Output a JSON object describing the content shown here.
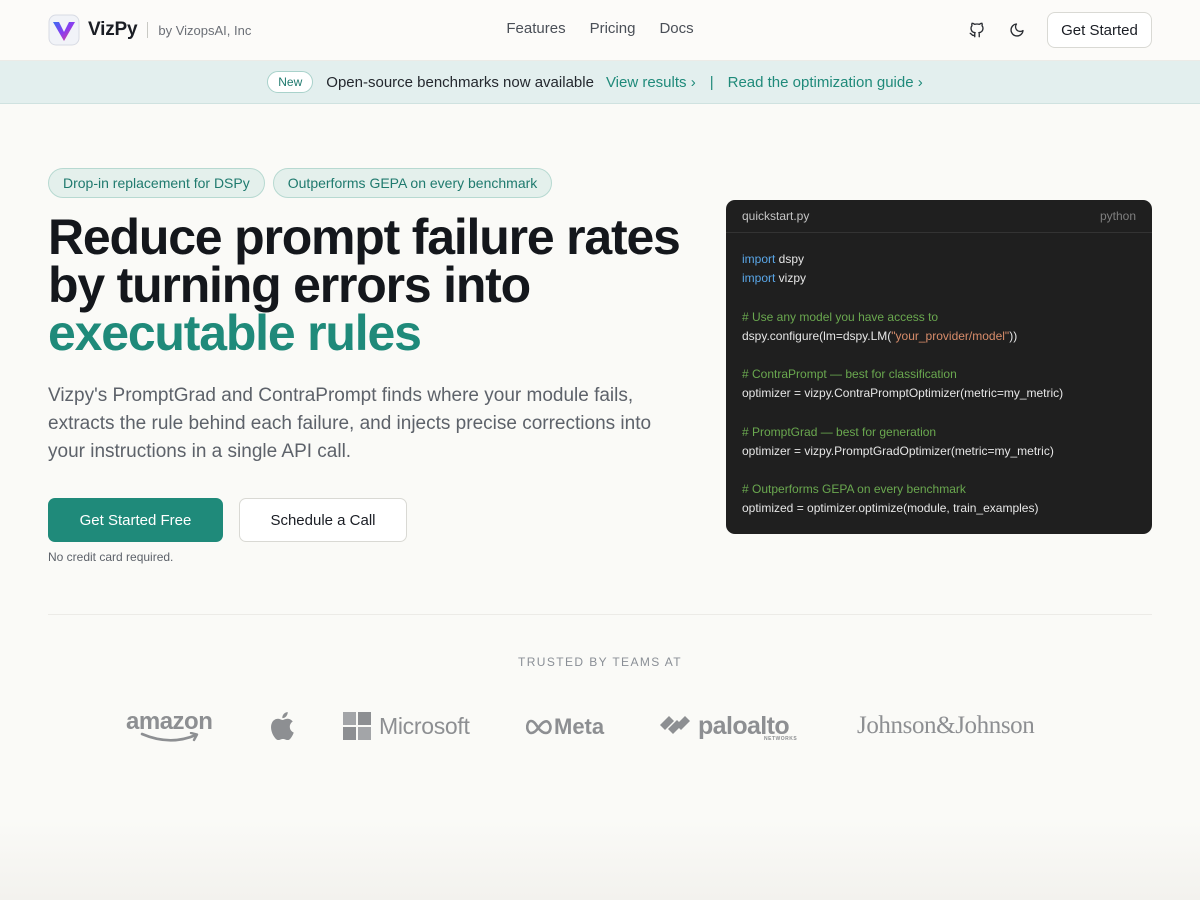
{
  "header": {
    "brand_name": "VizPy",
    "brand_by": "by VizopsAI, Inc",
    "nav": [
      "Features",
      "Pricing",
      "Docs"
    ],
    "cta_label": "Get Started",
    "icons": [
      "github-icon",
      "moon-icon"
    ]
  },
  "announcement": {
    "badge": "New",
    "text": "Open-source benchmarks now available",
    "link1": "View results ›",
    "separator": "|",
    "link2": "Read the optimization guide ›"
  },
  "hero": {
    "badges": [
      "Drop-in replacement for DSPy",
      "Outperforms GEPA on every benchmark"
    ],
    "title_line1": "Reduce prompt failure rates",
    "title_line2": "by turning errors into",
    "title_accent": "executable rules",
    "subtitle": "Vizpy's PromptGrad and ContraPrompt finds where your module fails, extracts the rule behind each failure, and injects precise corrections into your instructions in a single API call.",
    "primary_cta": "Get Started Free",
    "secondary_cta": "Schedule a Call",
    "note": "No credit card required."
  },
  "code": {
    "filename": "quickstart.py",
    "language": "python",
    "lines": [
      {
        "kw": "import",
        "rest": " dspy"
      },
      {
        "kw": "import",
        "rest": " vizpy"
      },
      {
        "blank": true
      },
      {
        "cm": "# Use any model you have access to"
      },
      {
        "pre": "dspy.configure(lm=dspy.LM(",
        "st": "\"your_provider/model\"",
        "post": "))"
      },
      {
        "blank": true
      },
      {
        "cm": "# ContraPrompt — best for classification"
      },
      {
        "text": "optimizer = vizpy.ContraPromptOptimizer(metric=my_metric)"
      },
      {
        "blank": true
      },
      {
        "cm": "# PromptGrad — best for generation"
      },
      {
        "text": "optimizer = vizpy.PromptGradOptimizer(metric=my_metric)"
      },
      {
        "blank": true
      },
      {
        "cm": "# Outperforms GEPA on every benchmark"
      },
      {
        "text": "optimized = optimizer.optimize(module, train_examples)"
      }
    ]
  },
  "trusted": {
    "label": "TRUSTED BY TEAMS AT",
    "logos": {
      "amazon": "amazon",
      "apple": "apple-logo",
      "microsoft": "Microsoft",
      "meta": "Meta",
      "paloalto": "paloalto",
      "paloalto_sub": "NETWORKS",
      "jnj": "Johnson&Johnson"
    }
  }
}
